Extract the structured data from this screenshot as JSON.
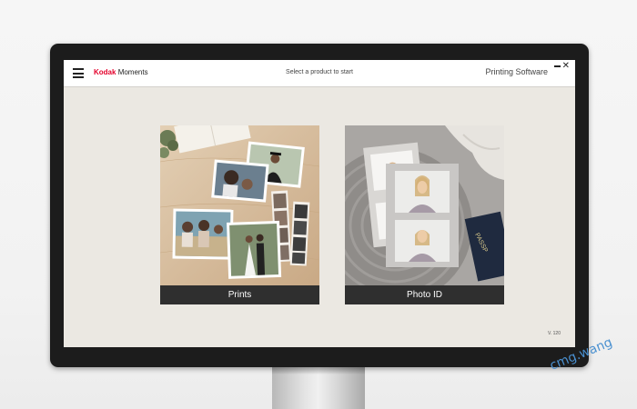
{
  "app": {
    "brand": "Kodak",
    "brand_sub": "Moments",
    "header_center": "Select a product to start",
    "header_right": "Printing Software",
    "version": "V. 120"
  },
  "tiles": [
    {
      "label": "Prints"
    },
    {
      "label": "Photo ID"
    }
  ],
  "photo_id": {
    "passport_text": "PASSP"
  },
  "watermark": "cmg.wang",
  "colors": {
    "brand_red": "#e4002b",
    "monitor_bezel": "#1c1c1c",
    "screen_bg": "#ebe8e2",
    "tile_label_bg": "#2f2f2f"
  },
  "icons": [
    "menu-icon",
    "minimize-icon",
    "close-icon"
  ]
}
